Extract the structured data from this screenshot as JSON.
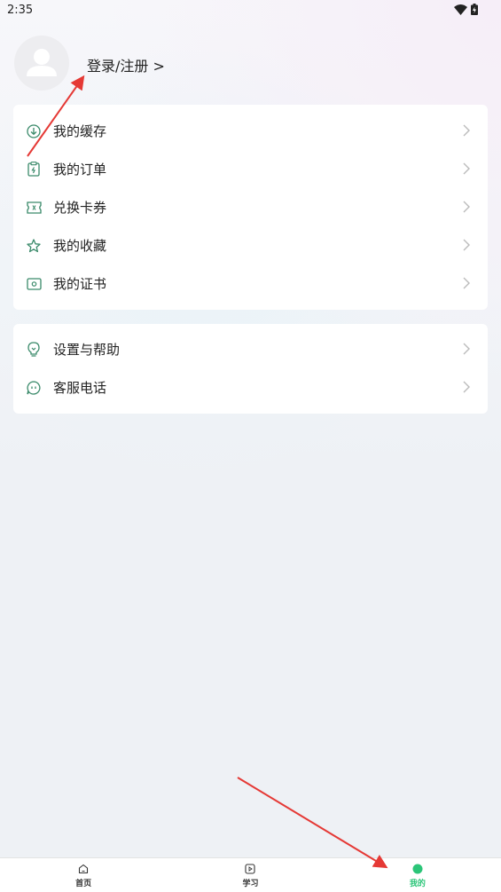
{
  "status_bar": {
    "time": "2:35",
    "wifi_icon": "wifi-icon",
    "battery_icon": "battery-charging-icon"
  },
  "profile": {
    "avatar_icon": "user-avatar-icon",
    "login_label": "登录/注册 >"
  },
  "menu_group_1": [
    {
      "icon": "download-icon",
      "label": "我的缓存"
    },
    {
      "icon": "order-clipboard-icon",
      "label": "我的订单"
    },
    {
      "icon": "ticket-icon",
      "label": "兑换卡券"
    },
    {
      "icon": "star-icon",
      "label": "我的收藏"
    },
    {
      "icon": "certificate-icon",
      "label": "我的证书"
    }
  ],
  "menu_group_2": [
    {
      "icon": "lightbulb-icon",
      "label": "设置与帮助"
    },
    {
      "icon": "chat-bubble-icon",
      "label": "客服电话"
    }
  ],
  "bottom_nav": {
    "items": [
      {
        "icon": "home-icon",
        "label": "首页"
      },
      {
        "icon": "play-icon",
        "label": "学习"
      },
      {
        "icon": "profile-dot-icon",
        "label": "我的"
      }
    ],
    "active_index": 2
  },
  "colors": {
    "accent": "#2bc578",
    "icon_green": "#3a8a6a",
    "arrow_red": "#e53935"
  }
}
